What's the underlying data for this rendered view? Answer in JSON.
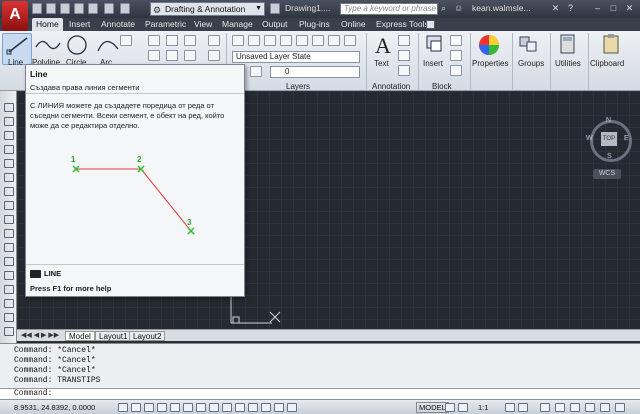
{
  "titlebar": {
    "logo": "A",
    "workspace": "Drafting & Annotation",
    "document_title": "Drawing1....",
    "search_placeholder": "Type a keyword or phrase",
    "user": "kean.walmsle..."
  },
  "tabs": [
    "Home",
    "Insert",
    "Annotate",
    "Parametric",
    "View",
    "Manage",
    "Output",
    "Plug-ins",
    "Online",
    "Express Tools"
  ],
  "ribbon": {
    "draw_tools": [
      "Line",
      "Polyline",
      "Circle",
      "Arc"
    ],
    "layer_state": "Unsaved Layer State",
    "layer_current": "0",
    "panels": [
      "Layers",
      "Annotation",
      "Block"
    ],
    "big_buttons": [
      "Text",
      "Insert",
      "Properties",
      "Groups",
      "Utilities",
      "Clipboard"
    ]
  },
  "tooltip": {
    "title": "Line",
    "subtitle": "Създава права линия сегменти",
    "body": "С ЛИНИЯ можете да създадете поредица от реда от съседни сегменти. Всеки сегмент, е обект на ред, който може да се редактира отделно.",
    "points": [
      "1",
      "2",
      "3"
    ],
    "command": "LINE",
    "help": "Press F1 for more help"
  },
  "viewcube": {
    "top": "TOP",
    "n": "N",
    "s": "S",
    "e": "E",
    "w": "W",
    "wcs": "WCS"
  },
  "layout_tabs": [
    "Model",
    "Layout1",
    "Layout2"
  ],
  "command_history": [
    "Command: *Cancel*",
    "Command: *Cancel*",
    "Command: *Cancel*",
    "Command: TRANSTIPS"
  ],
  "command_prompt": "Command:",
  "status": {
    "coordinates": "8.9531, 24.8392, 0.0000",
    "model": "MODEL",
    "scale": "1:1"
  },
  "colors": {
    "accent_red": "#d33333",
    "grid_bg": "#252a31",
    "line_red": "#e04040",
    "point_green": "#30c030"
  }
}
